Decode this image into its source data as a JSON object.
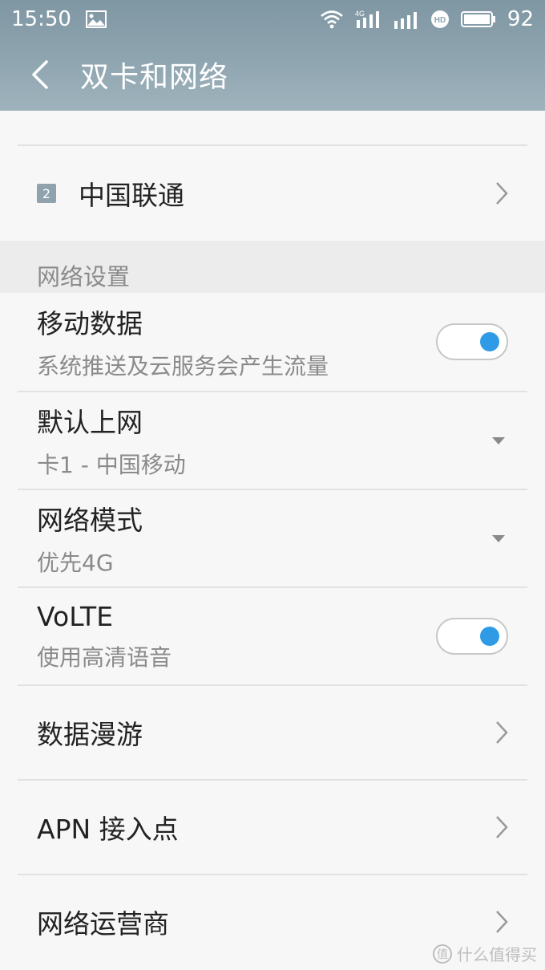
{
  "status_bar": {
    "time": "15:50",
    "battery_level": "92",
    "network_type": "4G",
    "hd_badge": "HD",
    "icons": [
      "image-icon",
      "wifi-icon",
      "signal-4g-icon",
      "signal-icon",
      "hd-icon",
      "battery-icon"
    ]
  },
  "header": {
    "title": "双卡和网络",
    "back_icon": "back-arrow-icon"
  },
  "sim_row": {
    "badge": "2",
    "label": "中国联通"
  },
  "network_settings": {
    "section_title": "网络设置",
    "mobile_data": {
      "title": "移动数据",
      "subtitle": "系统推送及云服务会产生流量",
      "enabled": true
    },
    "default_network": {
      "title": "默认上网",
      "value": "卡1 - 中国移动"
    },
    "network_mode": {
      "title": "网络模式",
      "value": "优先4G"
    },
    "volte": {
      "title": "VoLTE",
      "subtitle": "使用高清语音",
      "enabled": true
    },
    "data_roaming": {
      "title": "数据漫游"
    },
    "apn": {
      "title": "APN 接入点"
    },
    "carrier": {
      "title": "网络运营商"
    }
  },
  "watermark": {
    "text": "什么值得买",
    "logo": "值"
  },
  "colors": {
    "header_bg": "#8fa5b0",
    "accent": "#2f9be6",
    "secondary_text": "#8a8a8a"
  }
}
